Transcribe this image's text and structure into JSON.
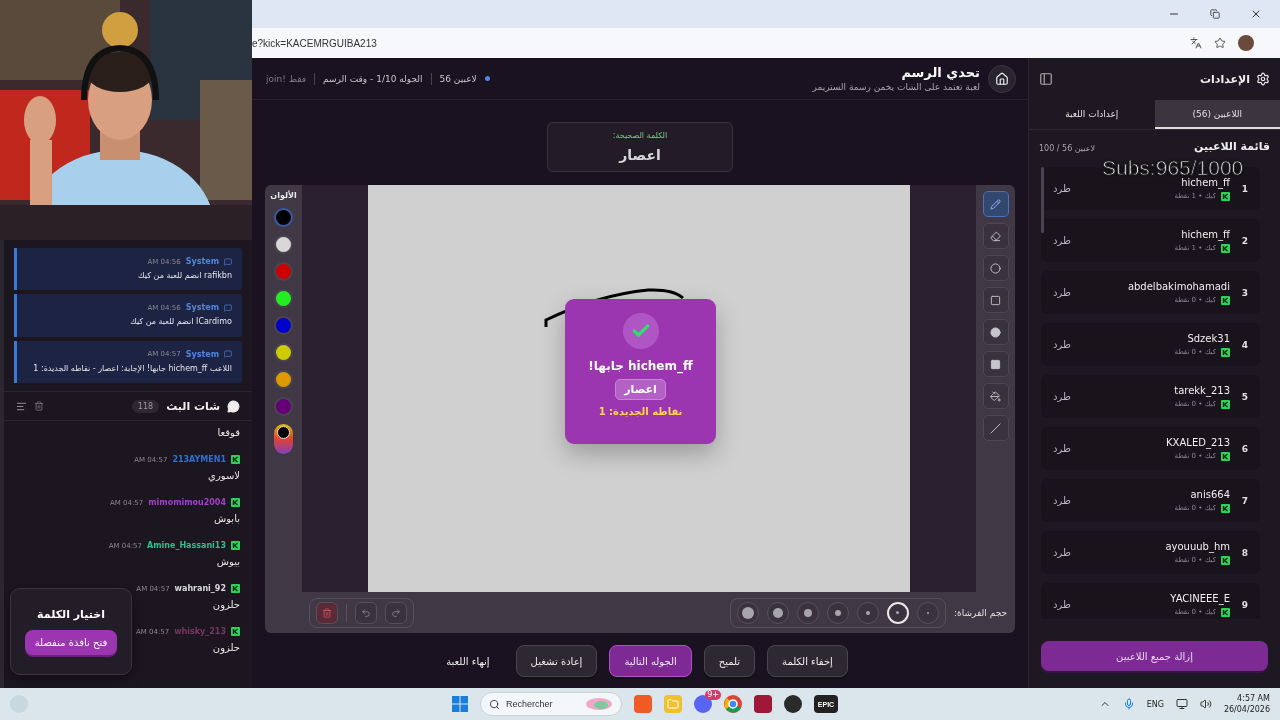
{
  "browser": {
    "url": "e?kick=KACEMRGUIBA213"
  },
  "stream_overlay": {
    "subs": "Subs:965/1000"
  },
  "system_messages": [
    {
      "author": "System",
      "time": "AM 04:56",
      "text": "rafikbn انضم للعبة من كيك"
    },
    {
      "author": "System",
      "time": "AM 04:56",
      "text": "ICardimo انضم للعبة من كيك"
    },
    {
      "author": "System",
      "time": "AM 04:57",
      "text": "اللاعب hichem_ff جابها! الإجابة: اعصار - نقاطه الجديدة: 1"
    }
  ],
  "chat": {
    "title": "شات البث",
    "count": "118",
    "messages": [
      {
        "text": "قوقعا"
      },
      {
        "user": "213AYMEN1",
        "color": "#2f6fd6",
        "time": "AM 04:57",
        "text": "لاسوري"
      },
      {
        "user": "mimomimou2004",
        "color": "#a23fc8",
        "time": "AM 04:57",
        "text": "بابوش"
      },
      {
        "user": "Amine_Hassani13",
        "color": "#2fbf8a",
        "time": "AM 04:57",
        "text": "بيوش"
      },
      {
        "user": "wahrani_92",
        "color": "#d8d8d8",
        "time": "AM 04:57",
        "text": "حلزون"
      },
      {
        "user": "whisky_213",
        "color": "#7a3560",
        "time": "AM 04:57",
        "text": "حلزون"
      }
    ]
  },
  "word_picker": {
    "title": "اختيار الكلمة",
    "button": "فتح نافذة منفصلة"
  },
  "header": {
    "title": "تحدي الرسم",
    "subtitle": "لعبة تعتمد على الشات يخمن رسمة الستريمر",
    "players": "56 لاعبين",
    "round": "الجوله 1/10 - وقت الرسم",
    "join": "فقط !join"
  },
  "word_card": {
    "label": "الكلمة الصحيحة:",
    "word": "اعصار"
  },
  "canvas": {
    "colors_label": "الألوان",
    "colors": [
      {
        "color": "#000000",
        "selected": true
      },
      {
        "color": "#d8d8d8",
        "selected": false
      },
      {
        "color": "#cc0000",
        "selected": false
      },
      {
        "color": "#22ee22",
        "selected": false
      },
      {
        "color": "#0000cc",
        "selected": false
      },
      {
        "color": "#cccc00",
        "selected": false
      },
      {
        "color": "#dd9900",
        "selected": false
      },
      {
        "color": "#660077",
        "selected": false
      }
    ],
    "tools": [
      {
        "kind": "pen",
        "selected": true
      },
      {
        "kind": "eraser",
        "selected": false
      },
      {
        "kind": "circle",
        "selected": false
      },
      {
        "kind": "rect",
        "selected": false
      },
      {
        "kind": "filled-circle",
        "selected": false
      },
      {
        "kind": "filled-rect",
        "selected": false
      },
      {
        "kind": "fill",
        "selected": false
      },
      {
        "kind": "line",
        "selected": false
      }
    ],
    "brush_label": "حجم الفرشاة:",
    "brush_sizes": [
      {
        "selected": false
      },
      {
        "selected": false
      },
      {
        "selected": false
      },
      {
        "selected": false
      },
      {
        "selected": false
      },
      {
        "selected": true
      },
      {
        "selected": false
      }
    ]
  },
  "popup": {
    "player": "hichem_ff جابها!",
    "word": "اعصار",
    "points": "نقاطه الجديدة: 1"
  },
  "actions": [
    {
      "label": "إخفاء الكلمة",
      "kind": "secondary"
    },
    {
      "label": "تلميح",
      "kind": "secondary"
    },
    {
      "label": "الجوله التالية",
      "kind": "primary"
    },
    {
      "label": "إعادة تشغيل",
      "kind": "secondary"
    },
    {
      "label": "إنهاء اللعبة",
      "kind": "text"
    }
  ],
  "sidebar": {
    "title": "الإعدادات",
    "tabs": [
      {
        "label": "اللاعبين (56)",
        "selected": true
      },
      {
        "label": "إعدادات اللعبة",
        "selected": false
      }
    ],
    "list_title": "قائمة اللاعبين",
    "list_count": "100 / 56 لاعبين",
    "players": [
      {
        "rank": "1",
        "name": "hichem_ff",
        "meta": "كيك • 1 نقطة",
        "action": "طرد"
      },
      {
        "rank": "2",
        "name": "hichem_ff",
        "meta": "كيك • 1 نقطة",
        "action": "طرد"
      },
      {
        "rank": "3",
        "name": "abdelbakimohamadi",
        "meta": "كيك • 0 نقطة",
        "action": "طرد"
      },
      {
        "rank": "4",
        "name": "Sdzek31",
        "meta": "كيك • 0 نقطة",
        "action": "طرد"
      },
      {
        "rank": "5",
        "name": "tarekk_213",
        "meta": "كيك • 0 نقطة",
        "action": "طرد"
      },
      {
        "rank": "6",
        "name": "KXALED_213",
        "meta": "كيك • 0 نقطة",
        "action": "طرد"
      },
      {
        "rank": "7",
        "name": "anis664",
        "meta": "كيك • 0 نقطة",
        "action": "طرد"
      },
      {
        "rank": "8",
        "name": "ayouuub_hm",
        "meta": "كيك • 0 نقطة",
        "action": "طرد"
      },
      {
        "rank": "9",
        "name": "YACINEEE_E",
        "meta": "كيك • 0 نقطة",
        "action": "طرد"
      }
    ],
    "remove_all": "إزالة جميع اللاعبين"
  },
  "taskbar": {
    "search": "Rechercher",
    "discord_badge": "9+",
    "epic": "EPIC",
    "lang": "ENG",
    "time": "4:57 AM",
    "date": "26/04/2026"
  }
}
